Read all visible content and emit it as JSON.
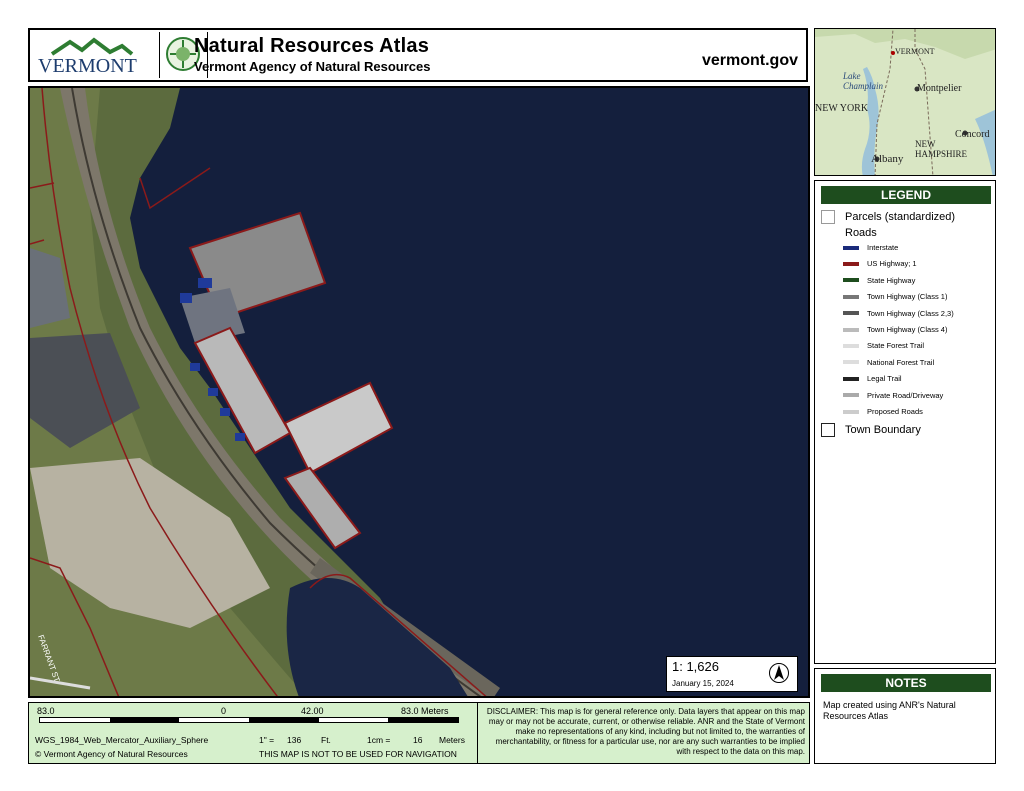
{
  "header": {
    "logo_text": "VERMONT",
    "title": "Natural Resources Atlas",
    "subtitle": "Vermont Agency of Natural Resources",
    "site": "vermont.gov"
  },
  "locator": {
    "labels": [
      "VERMONT",
      "Lake Champlain",
      "Montpelier",
      "NEW YORK",
      "Concord",
      "NEW HAMPSHIRE",
      "Albany"
    ]
  },
  "map": {
    "street_label": "FARRANT ST"
  },
  "legend": {
    "title": "LEGEND",
    "parcels": "Parcels (standardized)",
    "roads_heading": "Roads",
    "roads": [
      {
        "label": "Interstate",
        "color": "#1a2a7a"
      },
      {
        "label": "US Highway; 1",
        "color": "#8b1a1a"
      },
      {
        "label": "State Highway",
        "color": "#1e4d1e"
      },
      {
        "label": "Town Highway (Class 1)",
        "color": "#777777"
      },
      {
        "label": "Town Highway (Class 2,3)",
        "color": "#555555"
      },
      {
        "label": "Town Highway (Class 4)",
        "color": "#bbbbbb"
      },
      {
        "label": "State Forest Trail",
        "color": "#dddddd"
      },
      {
        "label": "National Forest Trail",
        "color": "#dddddd"
      },
      {
        "label": "Legal Trail",
        "color": "#222222"
      },
      {
        "label": "Private Road/Driveway",
        "color": "#aaaaaa"
      },
      {
        "label": "Proposed Roads",
        "color": "#cccccc"
      }
    ],
    "town_boundary": "Town Boundary"
  },
  "scale": {
    "ratio": "1:  1,626",
    "date": "January 15, 2024",
    "north_icon": "north-arrow-icon"
  },
  "notes": {
    "title": "NOTES",
    "text": "Map created using ANR's Natural Resources Atlas"
  },
  "footer": {
    "scale_left": "83.0",
    "scale_zero": "0",
    "scale_mid": "42.00",
    "scale_right": "83.0 Meters",
    "projection": "WGS_1984_Web_Mercator_Auxiliary_Sphere",
    "inch_label": "1\" =",
    "inch_value": "136",
    "inch_unit": "Ft.",
    "cm_label": "1cm =",
    "cm_value": "16",
    "cm_unit": "Meters",
    "agency": "© Vermont Agency of Natural Resources",
    "nav_warning": "THIS MAP IS NOT TO BE USED FOR NAVIGATION",
    "disclaimer": "DISCLAIMER: This map is for general reference only. Data layers that appear on this map may or may not be accurate, current, or otherwise reliable. ANR and the State of Vermont make no representations of any kind, including but not limited to, the warranties of merchantability, or fitness for a particular use, nor are any such warranties to be implied with respect to the data on this map."
  }
}
